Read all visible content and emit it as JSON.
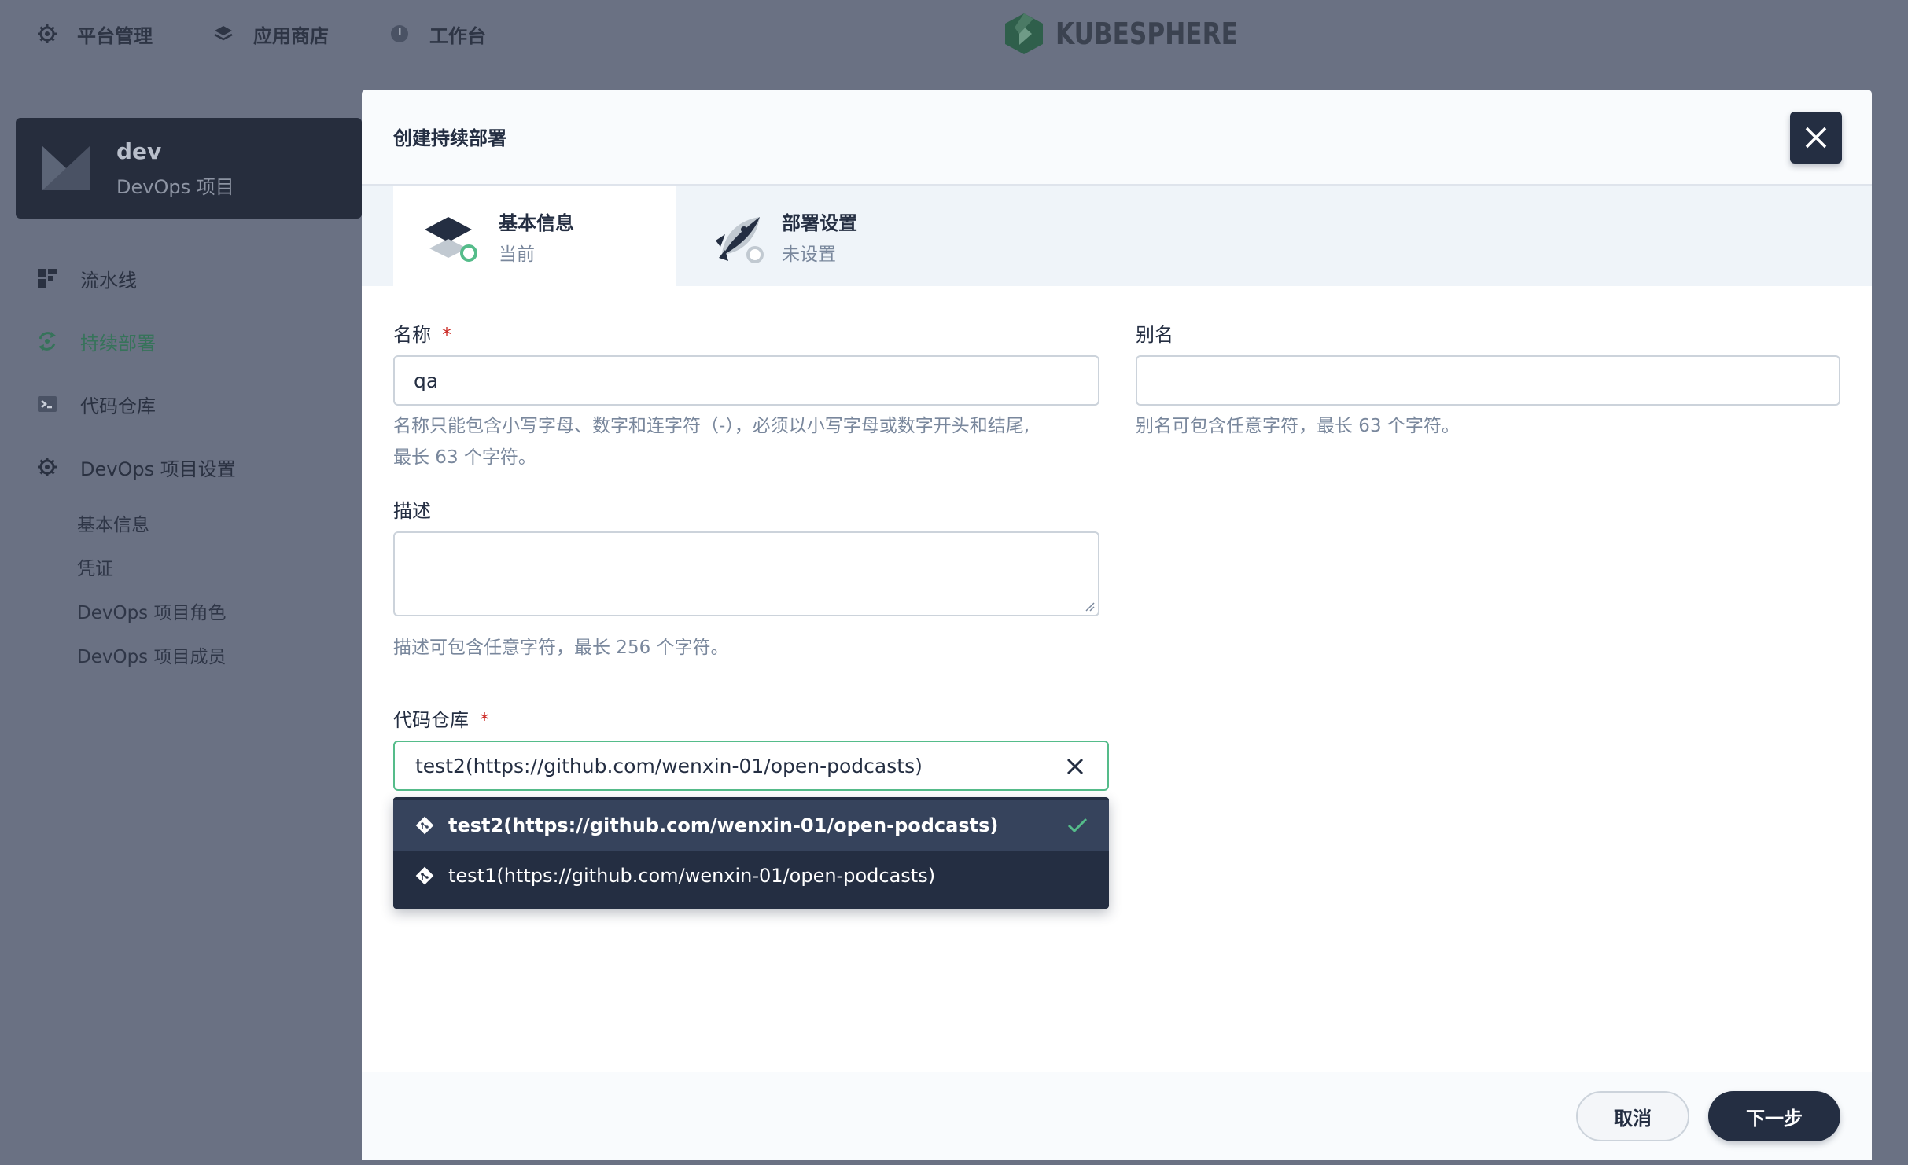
{
  "topnav": {
    "platform": "平台管理",
    "app_store": "应用商店",
    "workbench": "工作台",
    "brand": "KUBESPHERE",
    "platform_icon": "gear-icon",
    "app_store_icon": "layers-icon",
    "workbench_icon": "clock-icon"
  },
  "project": {
    "name": "dev",
    "type": "DevOps 项目"
  },
  "sidebar": {
    "items": [
      {
        "label": "流水线",
        "icon": "pipeline-icon",
        "active": false
      },
      {
        "label": "持续部署",
        "icon": "continuous-deploy-icon",
        "active": true
      },
      {
        "label": "代码仓库",
        "icon": "code-repo-icon",
        "active": false
      },
      {
        "label": "DevOps 项目设置",
        "icon": "gear-icon",
        "active": false
      }
    ],
    "settings_subitems": [
      "基本信息",
      "凭证",
      "DevOps 项目角色",
      "DevOps 项目成员"
    ]
  },
  "modal": {
    "title": "创建持续部署",
    "steps": [
      {
        "title": "基本信息",
        "status": "当前",
        "icon": "layers-icon"
      },
      {
        "title": "部署设置",
        "status": "未设置",
        "icon": "rocket-icon"
      }
    ],
    "form": {
      "name": {
        "label": "名称",
        "required_mark": "*",
        "value": "qa",
        "hint_line1": "名称只能包含小写字母、数字和连字符（-），必须以小写字母或数字开头和结尾,",
        "hint_line2": "最长 63 个字符。"
      },
      "alias": {
        "label": "别名",
        "value": "",
        "hint": "别名可包含任意字符，最长 63 个字符。"
      },
      "description": {
        "label": "描述",
        "value": "",
        "hint": "描述可包含任意字符，最长 256 个字符。"
      },
      "code_repo": {
        "label": "代码仓库",
        "required_mark": "*",
        "selected_value": "test2(https://github.com/wenxin-01/open-podcasts)",
        "options": [
          {
            "label": "test2(https://github.com/wenxin-01/open-podcasts)",
            "selected": true
          },
          {
            "label": "test1(https://github.com/wenxin-01/open-podcasts)",
            "selected": false
          }
        ]
      }
    },
    "footer": {
      "cancel": "取消",
      "next": "下一步"
    }
  },
  "colors": {
    "dark": "#242e42",
    "accent_green": "#55bc8a",
    "overlay": "#6a7183",
    "required_red": "#ca2621"
  }
}
